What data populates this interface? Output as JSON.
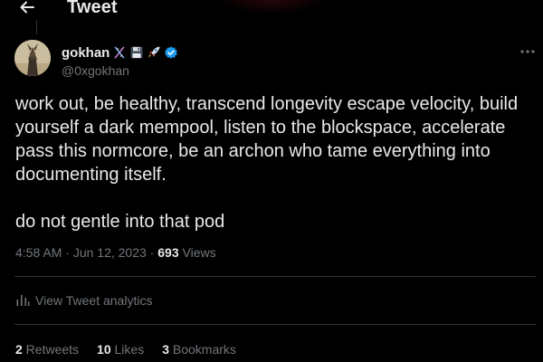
{
  "header": {
    "title": "Tweet",
    "back_icon": "arrow-left-icon"
  },
  "author": {
    "name": "gokhan",
    "handle": "@0xgokhan",
    "emojis": [
      "dna-icon",
      "floppy-disk-icon",
      "rocket-icon"
    ],
    "verified_icon": "verified-badge-icon",
    "verified_color": "#1d9bf0"
  },
  "tweet": {
    "paragraphs": [
      "work out, be healthy, transcend longevity escape velocity, build yourself a dark mempool, listen to the blockspace, accelerate pass this normcore, be an archon who tame everything into documenting itself.",
      "do not gentle into that pod"
    ]
  },
  "meta": {
    "time": "4:58 AM",
    "separator1": " · ",
    "date": "Jun 12, 2023",
    "separator2": " · ",
    "views_count": "693",
    "views_label": " Views"
  },
  "analytics": {
    "label": "View Tweet analytics",
    "icon": "bar-chart-icon"
  },
  "stats": {
    "retweets_count": "2",
    "retweets_label": " Retweets",
    "likes_count": "10",
    "likes_label": " Likes",
    "bookmarks_count": "3",
    "bookmarks_label": " Bookmarks"
  },
  "colors": {
    "background": "#000000",
    "text_primary": "#e7e9ea",
    "text_secondary": "#71767b",
    "divider": "#2f3336",
    "accent": "#1d9bf0"
  }
}
